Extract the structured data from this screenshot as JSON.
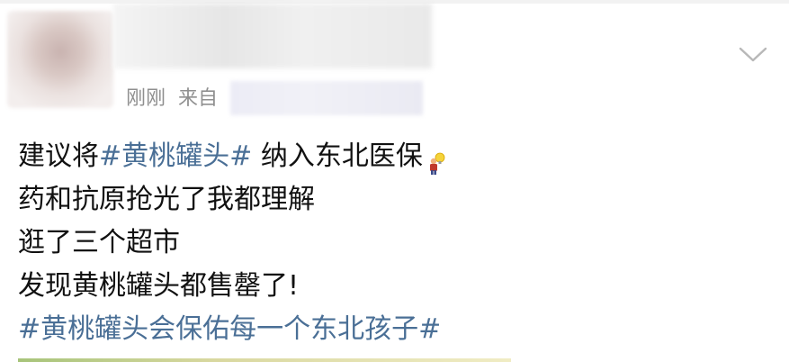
{
  "post": {
    "meta": {
      "time": "刚刚",
      "source_prefix": "来自"
    },
    "content": {
      "line1_prefix": "建议将",
      "line1_hashtag": "#黄桃罐头#",
      "line1_suffix": " 纳入东北医保",
      "line1_emoji": "person-with-lightbulb-icon",
      "line2": "药和抗原抢光了我都理解",
      "line3": "逛了三个超市",
      "line4": "发现黄桃罐头都售罄了!",
      "line5_hashtag": "#黄桃罐头会保佑每一个东北孩子#"
    },
    "colors": {
      "hashtag": "#4a6f96",
      "text": "#111111",
      "meta": "#8f8f8f"
    }
  }
}
